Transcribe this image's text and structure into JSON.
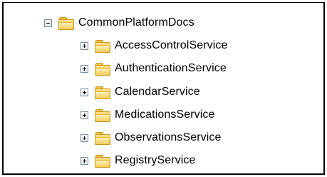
{
  "tree": {
    "root": {
      "label": "CommonPlatformDocs",
      "expanded": true,
      "icon": "folder-icon",
      "toggle_icon": "collapse-icon"
    },
    "children": [
      {
        "label": "AccessControlService",
        "expanded": false,
        "icon": "folder-icon",
        "toggle_icon": "expand-icon"
      },
      {
        "label": "AuthenticationService",
        "expanded": false,
        "icon": "folder-icon",
        "toggle_icon": "expand-icon"
      },
      {
        "label": "CalendarService",
        "expanded": false,
        "icon": "folder-icon",
        "toggle_icon": "expand-icon"
      },
      {
        "label": "MedicationsService",
        "expanded": false,
        "icon": "folder-icon",
        "toggle_icon": "expand-icon"
      },
      {
        "label": "ObservationsService",
        "expanded": false,
        "icon": "folder-icon",
        "toggle_icon": "expand-icon"
      },
      {
        "label": "RegistryService",
        "expanded": false,
        "icon": "folder-icon",
        "toggle_icon": "expand-icon"
      }
    ]
  },
  "colors": {
    "folder": "#f1bd3a",
    "toggle_border": "#7a8ea6",
    "frame_border": "#000000"
  }
}
